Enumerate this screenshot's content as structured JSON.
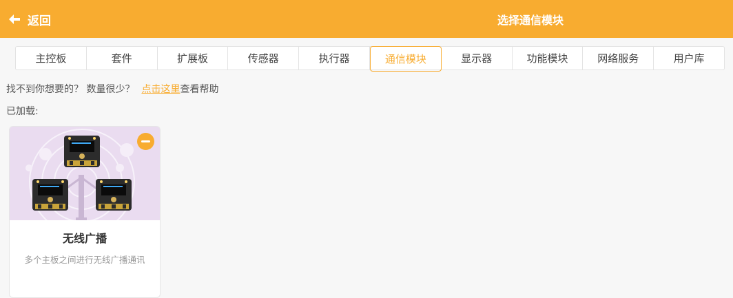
{
  "header": {
    "back_label": "返回",
    "title": "选择通信模块",
    "color": "#f8ac30"
  },
  "tabs": [
    {
      "label": "主控板",
      "active": false
    },
    {
      "label": "套件",
      "active": false
    },
    {
      "label": "扩展板",
      "active": false
    },
    {
      "label": "传感器",
      "active": false
    },
    {
      "label": "执行器",
      "active": false
    },
    {
      "label": "通信模块",
      "active": true
    },
    {
      "label": "显示器",
      "active": false
    },
    {
      "label": "功能模块",
      "active": false
    },
    {
      "label": "网络服务",
      "active": false
    },
    {
      "label": "用户库",
      "active": false
    }
  ],
  "help": {
    "prefix": "找不到你想要的？ 数量很少？",
    "link": "点击这里",
    "suffix": "查看帮助"
  },
  "loaded_label": "已加载:",
  "modules": [
    {
      "name": "无线广播",
      "description": "多个主板之间进行无线广播通讯",
      "icon": "broadcast-boards-image",
      "remove_icon": "minus-circle-icon"
    }
  ]
}
